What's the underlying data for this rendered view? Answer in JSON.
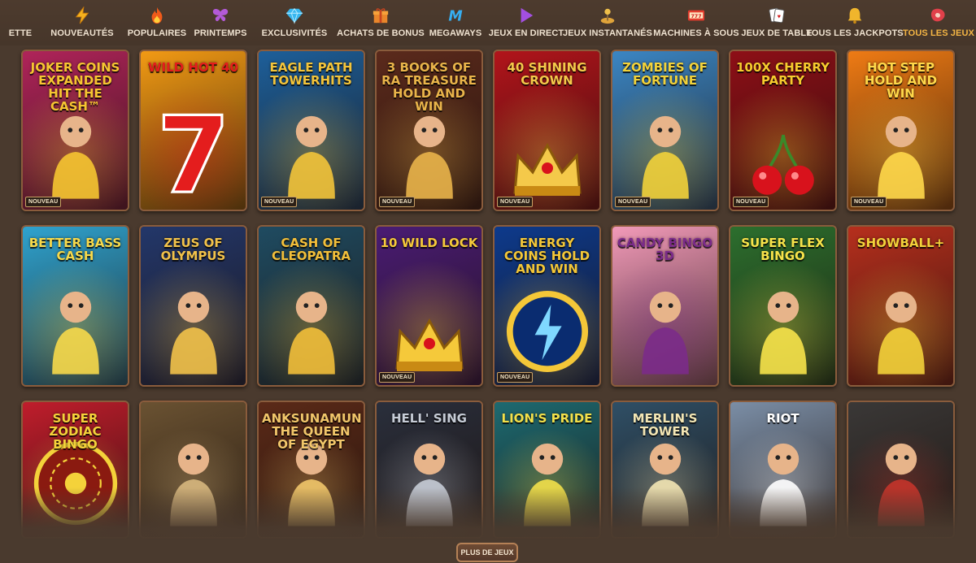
{
  "nav": {
    "categories": [
      {
        "label": "ETTE",
        "icon": "cut-off-icon"
      },
      {
        "label": "NOUVEAUTÉS",
        "icon": "lightning-icon"
      },
      {
        "label": "POPULAIRES",
        "icon": "flame-icon"
      },
      {
        "label": "PRINTEMPS",
        "icon": "butterfly-icon"
      },
      {
        "label": "EXCLUSIVITÉS",
        "icon": "diamond-icon"
      },
      {
        "label": "ACHATS DE BONUS",
        "icon": "gift-icon"
      },
      {
        "label": "MEGAWAYS",
        "icon": "megaways-icon"
      },
      {
        "label": "JEUX EN DIRECT",
        "icon": "play-icon"
      },
      {
        "label": "JEUX INSTANTANÉS",
        "icon": "joystick-icon"
      },
      {
        "label": "MACHINES À SOUS",
        "icon": "slot-machine-icon"
      },
      {
        "label": "JEUX DE TABLE",
        "icon": "cards-icon"
      },
      {
        "label": "TOUS LES JACKPOTS",
        "icon": "bell-icon"
      },
      {
        "label": "TOUS LES JEUX",
        "icon": "steak-icon"
      }
    ],
    "active_index": 12
  },
  "games": {
    "new_badge": "NOUVEAU",
    "rows": [
      [
        {
          "title": "JOKER COINS Expanded HIT THE CASH™",
          "bg": "#b0245a",
          "accent": "#f6c531",
          "new": true
        },
        {
          "title": "WILD HOT 40",
          "bg": "#f29a14",
          "accent": "#e41d1d",
          "new": false
        },
        {
          "title": "EAGLE PATH TOWERHITS",
          "bg": "#1d5f9a",
          "accent": "#f3c43a",
          "new": true
        },
        {
          "title": "3 BOOKS OF RA TREASURE HOLD AND WIN",
          "bg": "#5b2a1c",
          "accent": "#e9b44a",
          "new": true
        },
        {
          "title": "40 SHINING CROWN",
          "bg": "#b2141b",
          "accent": "#f4c94a",
          "new": true
        },
        {
          "title": "ZOMBIES OF FORTUNE",
          "bg": "#3b86c4",
          "accent": "#f2d23a",
          "new": true
        },
        {
          "title": "100x CHERRY PARTY",
          "bg": "#8e0f17",
          "accent": "#f6cb2e",
          "new": true
        },
        {
          "title": "HOT STEP HOLD AND WIN",
          "bg": "#ef7b14",
          "accent": "#ffd84a",
          "new": true
        }
      ],
      [
        {
          "title": "BETTER BASS CASH",
          "bg": "#2fa3cf",
          "accent": "#f7d94a",
          "new": false
        },
        {
          "title": "ZEUS OF OLYMPUS",
          "bg": "#23376a",
          "accent": "#f2c24a",
          "new": false
        },
        {
          "title": "CASH OF CLEOPATRA",
          "bg": "#1f4b61",
          "accent": "#f2bf3a",
          "new": false
        },
        {
          "title": "10 WILD LOCK",
          "bg": "#4a1c74",
          "accent": "#f5c93a",
          "new": true
        },
        {
          "title": "ENERGY COINS HOLD AND WIN",
          "bg": "#0d3a8c",
          "accent": "#f4c738",
          "new": true
        },
        {
          "title": "Candy Bingo 3D",
          "bg": "#f29ab9",
          "accent": "#7b2b8a",
          "new": false
        },
        {
          "title": "SUPER FLEX BINGO",
          "bg": "#2c6f2e",
          "accent": "#f7e34a",
          "new": false
        },
        {
          "title": "ShowBall+",
          "bg": "#b62f1d",
          "accent": "#f3d23a",
          "new": false
        }
      ],
      [
        {
          "title": "SUPER ZODIAC BINGO",
          "bg": "#c01d2c",
          "accent": "#f4d23a",
          "new": false
        },
        {
          "title": "",
          "bg": "#6a5232",
          "accent": "#d7b77e",
          "new": false
        },
        {
          "title": "ANKSUNAMUN THE QUEEN OF EGYPT",
          "bg": "#5b2a18",
          "accent": "#f1c66a",
          "new": false
        },
        {
          "title": "HELL' SING",
          "bg": "#2a2f3c",
          "accent": "#c6ccd6",
          "new": false
        },
        {
          "title": "LION's PRIDE",
          "bg": "#1d6a71",
          "accent": "#f2e04a",
          "new": false
        },
        {
          "title": "Merlin's Tower",
          "bg": "#2f4f66",
          "accent": "#f3e6b4",
          "new": false
        },
        {
          "title": "RIOT",
          "bg": "#7b8ea6",
          "accent": "#ffffff",
          "new": false
        },
        {
          "title": "",
          "bg": "#3a3837",
          "accent": "#c4342b",
          "new": false
        }
      ]
    ]
  },
  "more_button": "PLUS DE JEUX",
  "colors": {
    "background": "#4a3a2e",
    "active": "#f4b544",
    "tile_border": "#8a5c3c"
  }
}
